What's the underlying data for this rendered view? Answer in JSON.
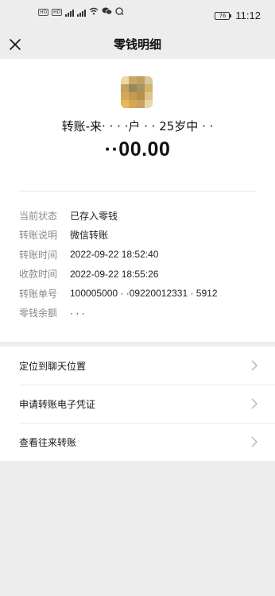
{
  "status_bar": {
    "sim1": "HD",
    "sim2": "HD",
    "net1": "4G",
    "net2": "4G",
    "battery": "76",
    "time": "11:12"
  },
  "nav": {
    "title": "零钱明细"
  },
  "transfer": {
    "source": "转账-来·  · ·  ·户 · · 25岁中 · ·",
    "amount": "··00.00"
  },
  "details": [
    {
      "label": "当前状态",
      "value": "已存入零钱"
    },
    {
      "label": "转账说明",
      "value": "微信转账"
    },
    {
      "label": "转账时间",
      "value": "2022-09-22 18:52:40"
    },
    {
      "label": "收款时间",
      "value": "2022-09-22 18:55:26"
    },
    {
      "label": "转账单号",
      "value": "100005000 ·  ·09220012331 · 5912"
    },
    {
      "label": "零钱余额",
      "value": "· · ·"
    }
  ],
  "actions": [
    {
      "label": "定位到聊天位置"
    },
    {
      "label": "申请转账电子凭证"
    },
    {
      "label": "查看往来转账"
    }
  ],
  "colors": {
    "background": "#ededed",
    "card": "#ffffff",
    "label_gray": "#8a8a8a",
    "text": "#191919"
  }
}
